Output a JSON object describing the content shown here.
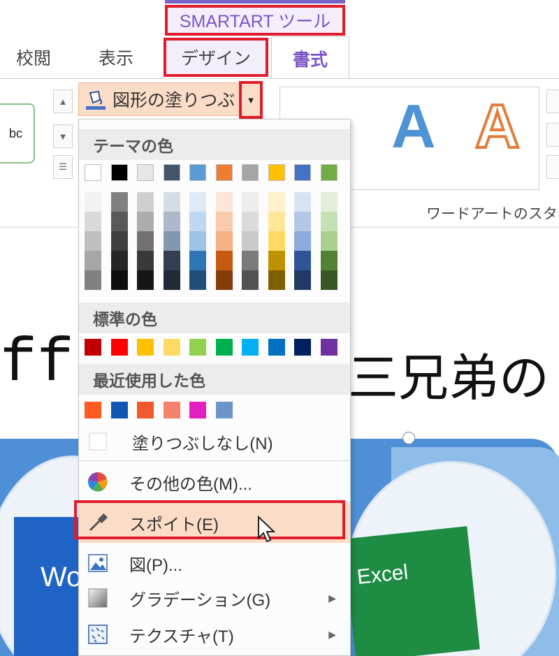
{
  "ribbon": {
    "context_label": "SMARTART ツール",
    "tabs": [
      {
        "label": "校閲"
      },
      {
        "label": "表示"
      },
      {
        "label": "デザイン"
      },
      {
        "label": "書式"
      }
    ],
    "style_preview_text": "bc",
    "fill_button_label": "図形の塗りつぶし",
    "wordart_sample_letter": "A",
    "wordart_group_label": "ワードアートのスタイ"
  },
  "document": {
    "title_left": "ff",
    "title_right": "三兄弟の",
    "word_box_text": "Wo",
    "excel_box_text": "Excel"
  },
  "menu": {
    "theme_header": "テーマの色",
    "standard_header": "標準の色",
    "recent_header": "最近使用した色",
    "theme_top_row": [
      "#ffffff",
      "#000000",
      "#e7e6e6",
      "#44546a",
      "#5b9bd5",
      "#ed7d31",
      "#a5a5a5",
      "#ffc000",
      "#4472c4",
      "#70ad47"
    ],
    "theme_shades": [
      [
        "#f2f2f2",
        "#d9d9d9",
        "#bfbfbf",
        "#a6a6a6",
        "#808080"
      ],
      [
        "#808080",
        "#595959",
        "#404040",
        "#262626",
        "#0d0d0d"
      ],
      [
        "#d0cece",
        "#aeabab",
        "#767171",
        "#3b3838",
        "#171616"
      ],
      [
        "#d6dce5",
        "#adb9ca",
        "#8497b0",
        "#333f50",
        "#222a35"
      ],
      [
        "#deebf7",
        "#bdd7ee",
        "#9dc3e6",
        "#2e75b6",
        "#1f4e79"
      ],
      [
        "#fbe5d6",
        "#f8cbad",
        "#f4b183",
        "#c55a11",
        "#843c0c"
      ],
      [
        "#ededed",
        "#dbdbdb",
        "#c9c9c9",
        "#7b7b7b",
        "#525252"
      ],
      [
        "#fff2cc",
        "#ffe699",
        "#ffd966",
        "#bf9000",
        "#7f6000"
      ],
      [
        "#dae3f3",
        "#b4c7e7",
        "#8faadc",
        "#2f5597",
        "#203864"
      ],
      [
        "#e2f0d9",
        "#c5e0b4",
        "#a9d18e",
        "#548235",
        "#385723"
      ]
    ],
    "standard_colors": [
      "#c00000",
      "#ff0000",
      "#ffc000",
      "#ffd966",
      "#92d050",
      "#00b050",
      "#00b0f0",
      "#0070c0",
      "#002060",
      "#7030a0"
    ],
    "recent_colors": [
      "#ff5a1f",
      "#0f57b5",
      "#f0592a",
      "#f5826c",
      "#e21fc0",
      "#6d93c9"
    ],
    "items": {
      "no_fill": "塗りつぶしなし(N)",
      "more_colors": "その他の色(M)...",
      "eyedropper": "スポイト(E)",
      "picture": "図(P)...",
      "gradient": "グラデーション(G)",
      "texture": "テクスチャ(T)"
    },
    "icons": {
      "no_fill": "blank-swatch-icon",
      "more_colors": "color-wheel-icon",
      "eyedropper": "eyedropper-icon",
      "picture": "picture-icon",
      "gradient": "gradient-icon",
      "texture": "texture-icon"
    }
  },
  "colors": {
    "highlight_red": "#e01c2c",
    "accent_purple": "#7a55c6",
    "hover_peach": "#fbdcc6"
  }
}
